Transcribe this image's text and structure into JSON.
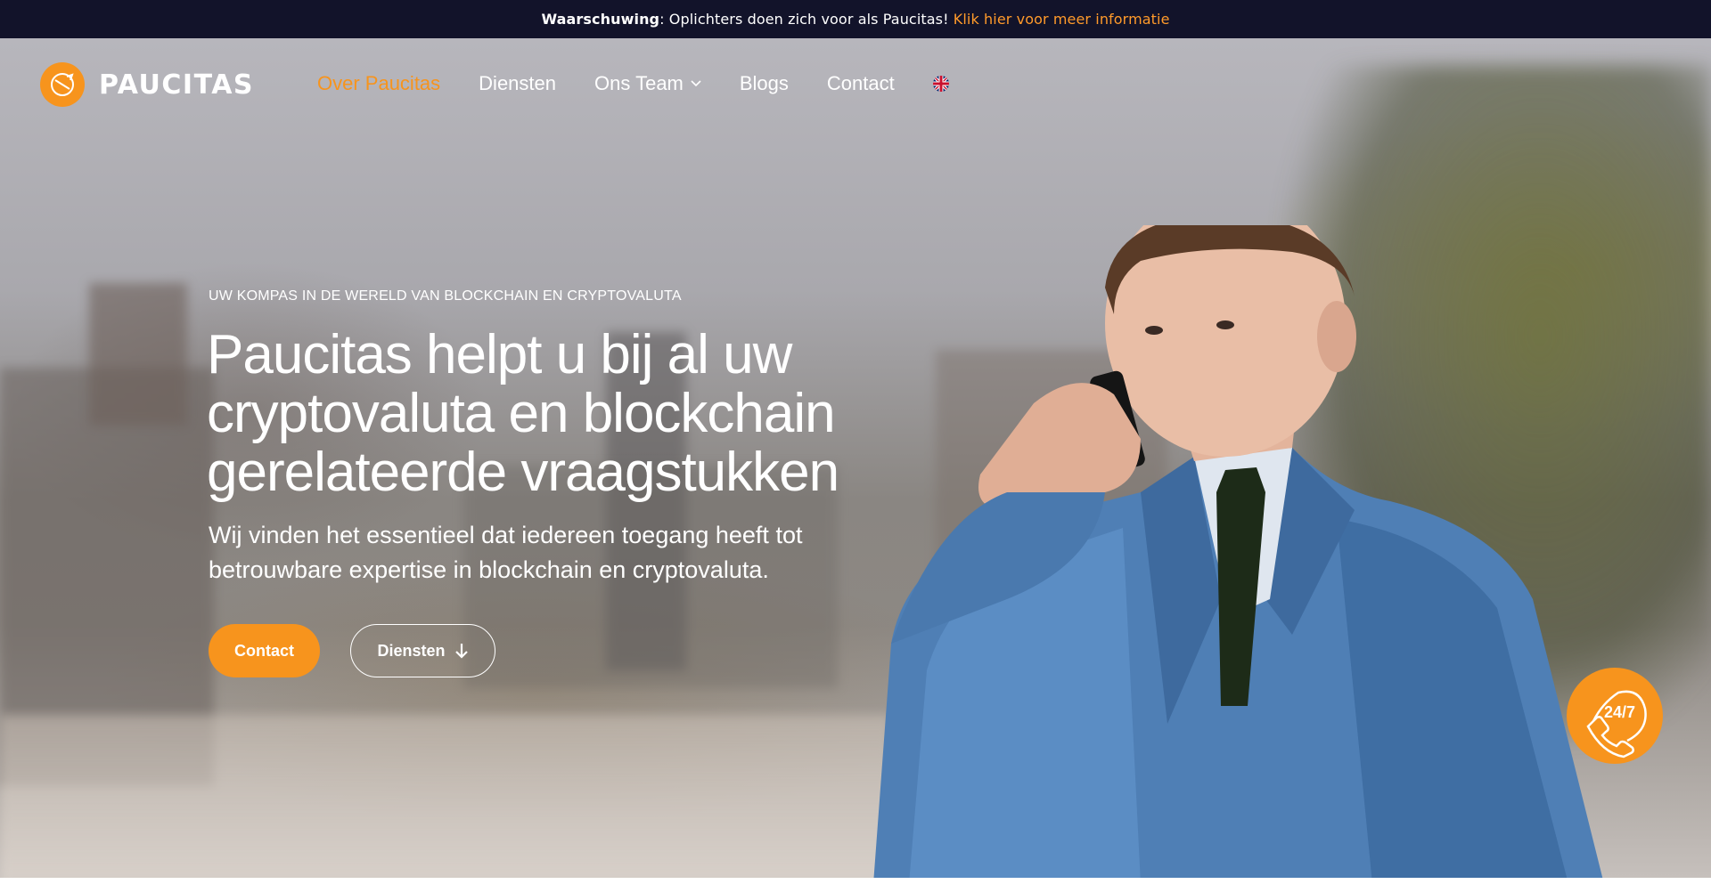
{
  "warning": {
    "bold": "Waarschuwing",
    "text": ": Oplichters doen zich voor als Paucitas! ",
    "link": "Klik hier voor meer informatie"
  },
  "logo": {
    "text": "PAUCITAS"
  },
  "nav": {
    "items": [
      {
        "label": "Over Paucitas",
        "active": true
      },
      {
        "label": "Diensten"
      },
      {
        "label": "Ons Team"
      },
      {
        "label": "Blogs"
      },
      {
        "label": "Contact"
      }
    ],
    "language_icon": "uk-flag-icon"
  },
  "hero": {
    "eyebrow": "UW KOMPAS IN DE WERELD VAN BLOCKCHAIN EN CRYPTOVALUTA",
    "headline": "Paucitas helpt u bij al uw cryptovaluta en blockchain gerelateerde vraagstukken",
    "subtext": "Wij vinden het essentieel dat iedereen toegang heeft tot betrouwbare expertise in blockchain en cryptovaluta.",
    "contact_button": "Contact",
    "diensten_button": "Diensten"
  },
  "support": {
    "label": "24/7",
    "icon": "phone-24-7-icon"
  },
  "colors": {
    "accent": "#f7941d",
    "topbar": "#12132a"
  }
}
